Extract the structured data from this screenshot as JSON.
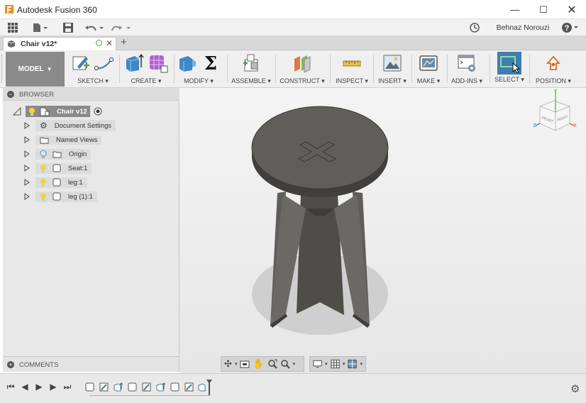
{
  "window": {
    "title": "Autodesk Fusion 360",
    "controls": [
      "minimize",
      "maximize",
      "close"
    ]
  },
  "quick_access": {
    "user_name": "Behnaz Norouzi",
    "help_label": "?"
  },
  "document_tab": {
    "name": "Chair v12*",
    "new_tab_symbol": "+"
  },
  "toolbar": {
    "workspace": "MODEL",
    "groups": [
      {
        "label": "SKETCH"
      },
      {
        "label": "CREATE"
      },
      {
        "label": "MODIFY"
      },
      {
        "label": "ASSEMBLE"
      },
      {
        "label": "CONSTRUCT"
      },
      {
        "label": "INSPECT"
      },
      {
        "label": "INSERT"
      },
      {
        "label": "MAKE"
      },
      {
        "label": "ADD-INS"
      },
      {
        "label": "SELECT"
      },
      {
        "label": "POSITION"
      }
    ]
  },
  "browser": {
    "title": "BROWSER",
    "root": "Chair v12",
    "items": [
      {
        "label": "Document Settings",
        "icon": "gear-icon"
      },
      {
        "label": "Named Views",
        "icon": "folder-icon"
      },
      {
        "label": "Origin",
        "icon": "folder-icon"
      },
      {
        "label": "Seat:1",
        "icon": "component-icon"
      },
      {
        "label": "leg:1",
        "icon": "component-icon"
      },
      {
        "label": "leg (1):1",
        "icon": "component-icon"
      }
    ]
  },
  "comments": {
    "title": "COMMENTS"
  },
  "viewcube": {
    "axis_x": "X",
    "axis_y": "Y",
    "axis_z": "Z",
    "face_front": "FRONT",
    "face_right": "RIGHT"
  },
  "colors": {
    "accent": "#3c7fb1",
    "model_body": "#5e5d58",
    "toolbar_bg": "#efefef"
  }
}
